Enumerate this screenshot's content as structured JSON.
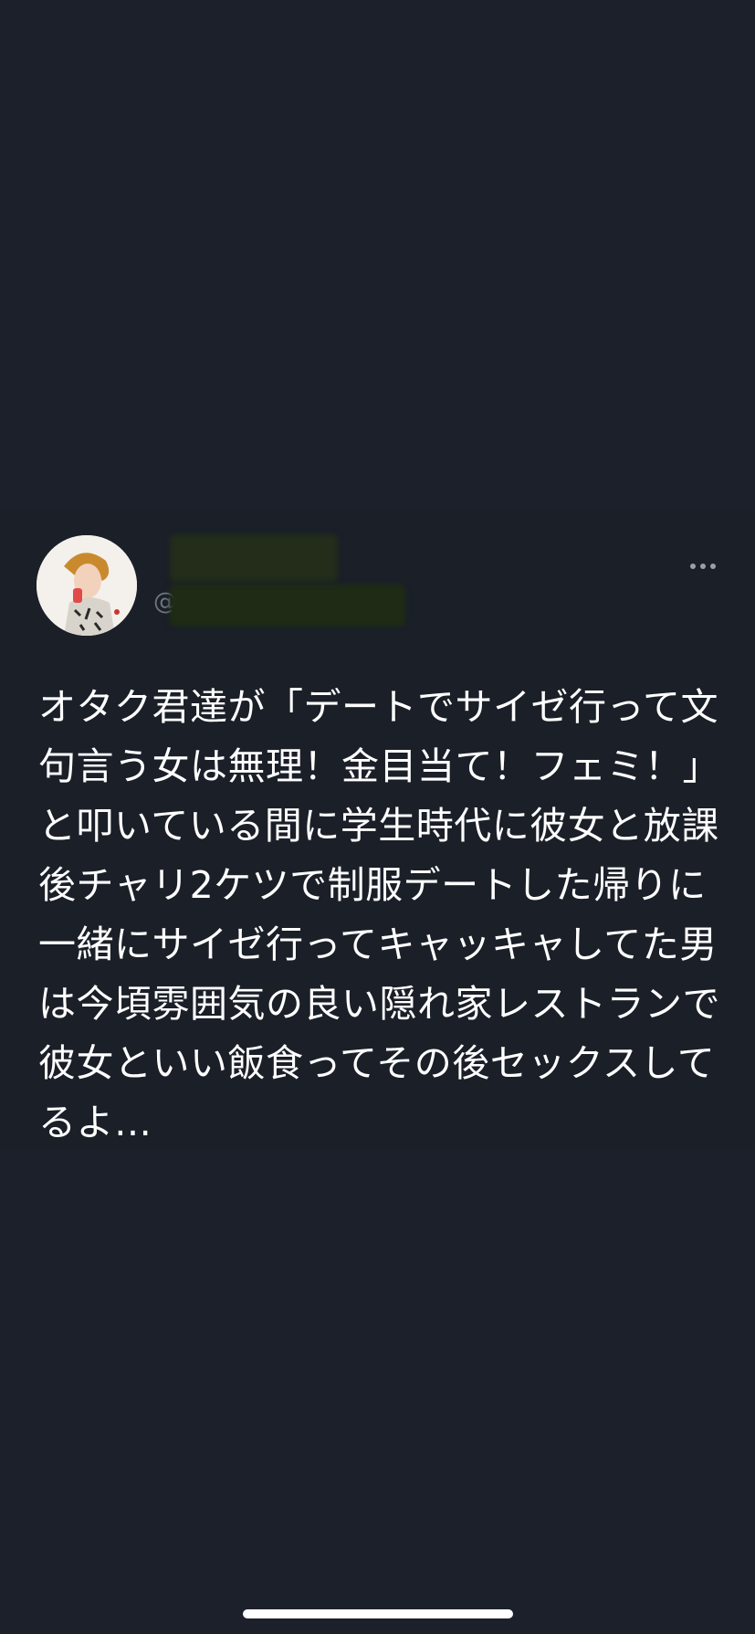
{
  "tweet": {
    "display_name": "",
    "handle": "@",
    "avatar_icon": "profile-avatar-illustration",
    "more_icon": "more-options-icon",
    "text": "オタク君達が「デートでサイゼ行って文句言う女は無理！金目当て！フェミ！」と叩いている間に学生時代に彼女と放課後チャリ2ケツで制服デートした帰りに一緒にサイゼ行ってキャッキャしてた男は今頃雰囲気の良い隠れ家レストランで彼女といい飯食ってその後セックスしてるよ…"
  },
  "colors": {
    "background": "#1b202b",
    "text": "#ffffff",
    "muted": "#6f7682"
  }
}
